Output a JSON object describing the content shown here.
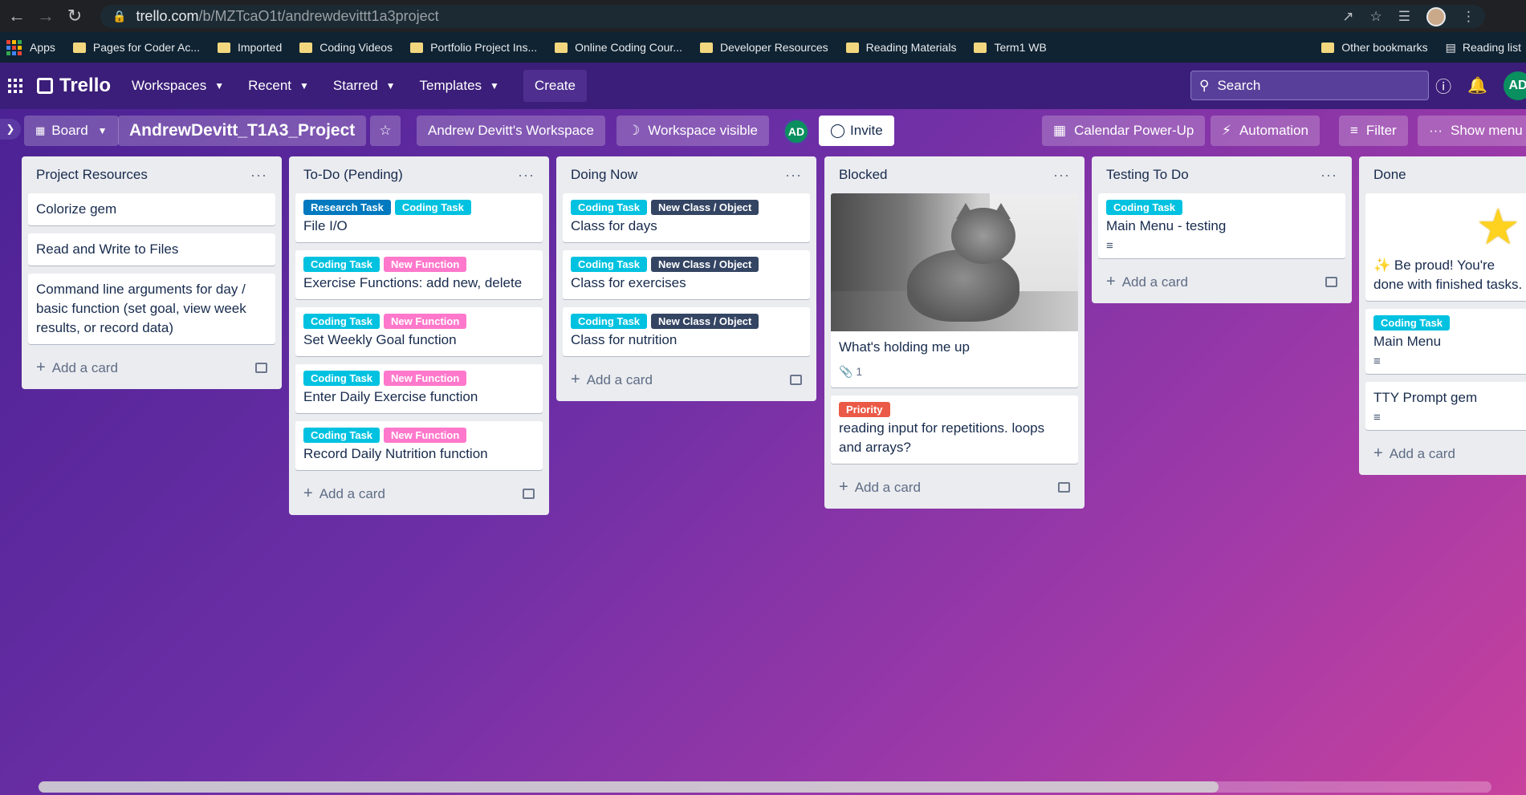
{
  "browser": {
    "url_host": "trello.com",
    "url_path": "/b/MZTcaO1t/andrewdevittt1a3project",
    "bookmarks": [
      {
        "label": "Apps"
      },
      {
        "label": "Pages for Coder Ac..."
      },
      {
        "label": "Imported"
      },
      {
        "label": "Coding Videos"
      },
      {
        "label": "Portfolio Project Ins..."
      },
      {
        "label": "Online Coding Cour..."
      },
      {
        "label": "Developer Resources"
      },
      {
        "label": "Reading Materials"
      },
      {
        "label": "Term1 WB"
      }
    ],
    "other_bookmarks": "Other bookmarks",
    "reading_list": "Reading list"
  },
  "header": {
    "logo": "Trello",
    "nav": [
      "Workspaces",
      "Recent",
      "Starred",
      "Templates"
    ],
    "create": "Create",
    "search_placeholder": "Search",
    "avatar": "AD"
  },
  "boardbar": {
    "view": "Board",
    "title": "AndrewDevitt_T1A3_Project",
    "workspace": "Andrew Devitt's Workspace",
    "visibility": "Workspace visible",
    "member": "AD",
    "invite": "Invite",
    "calendar": "Calendar Power-Up",
    "automation": "Automation",
    "filter": "Filter",
    "show_menu": "Show menu"
  },
  "add_card": "Add a card",
  "lists": [
    {
      "title": "Project Resources",
      "cards": [
        {
          "text": "Colorize gem"
        },
        {
          "text": "Read and Write to Files"
        },
        {
          "text": "Command line arguments for day / basic function (set goal, view week results, or record data)"
        }
      ]
    },
    {
      "title": "To-Do (Pending)",
      "cards": [
        {
          "labels": [
            "Research Task",
            "Coding Task"
          ],
          "text": "File I/O"
        },
        {
          "labels": [
            "Coding Task",
            "New Function"
          ],
          "text": "Exercise Functions: add new, delete"
        },
        {
          "labels": [
            "Coding Task",
            "New Function"
          ],
          "text": "Set Weekly Goal function"
        },
        {
          "labels": [
            "Coding Task",
            "New Function"
          ],
          "text": "Enter Daily Exercise function"
        },
        {
          "labels": [
            "Coding Task",
            "New Function"
          ],
          "text": "Record Daily Nutrition function"
        }
      ]
    },
    {
      "title": "Doing Now",
      "cards": [
        {
          "labels": [
            "Coding Task",
            "New Class / Object"
          ],
          "text": "Class for days"
        },
        {
          "labels": [
            "Coding Task",
            "New Class / Object"
          ],
          "text": "Class for exercises"
        },
        {
          "labels": [
            "Coding Task",
            "New Class / Object"
          ],
          "text": "Class for nutrition"
        }
      ]
    },
    {
      "title": "Blocked",
      "cards": [
        {
          "text": "What's holding me up",
          "attachments": "1"
        },
        {
          "labels": [
            "Priority"
          ],
          "text": "reading input for repetitions. loops and arrays?"
        }
      ]
    },
    {
      "title": "Testing To Do",
      "cards": [
        {
          "labels": [
            "Coding Task"
          ],
          "text": "Main Menu - testing"
        }
      ]
    },
    {
      "title": "Done",
      "cards": [
        {
          "text": "Be proud! You're done with finished tasks."
        },
        {
          "labels": [
            "Coding Task"
          ],
          "text": "Main Menu"
        },
        {
          "text": "TTY Prompt gem"
        }
      ]
    }
  ],
  "colors": {
    "research": "#0079bf",
    "coding": "#00c2e0",
    "new_function": "#ff78cb",
    "new_class": "#344563",
    "priority": "#eb5a46"
  }
}
